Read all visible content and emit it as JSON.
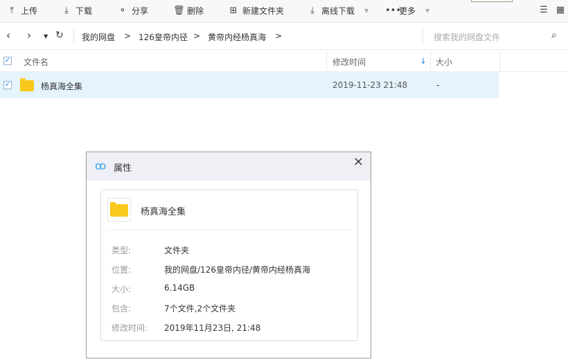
{
  "toolbar": {
    "upload": "上传",
    "download": "下载",
    "share": "分享",
    "delete": "删除",
    "new_folder": "新建文件夹",
    "offline_download": "离线下载",
    "more": "更多"
  },
  "nav": {
    "breadcrumb": [
      "我的网盘",
      "126皇帝内径",
      "黄帝内经杨真海"
    ],
    "search_placeholder": "搜索我的网盘文件"
  },
  "table": {
    "headers": {
      "name": "文件名",
      "modified": "修改时间",
      "size": "大小"
    },
    "rows": [
      {
        "name": "杨真海全集",
        "modified": "2019-11-23 21:48",
        "size": "-"
      }
    ]
  },
  "dialog": {
    "title": "属性",
    "file_name": "杨真海全集",
    "fields": [
      {
        "label": "类型:",
        "value": "文件夹"
      },
      {
        "label": "位置:",
        "value": "我的网盘/126皇帝内径/黄帝内经杨真海"
      },
      {
        "label": "大小:",
        "value": "6.14GB"
      },
      {
        "label": "包含:",
        "value": "7个文件,2个文件夹"
      },
      {
        "label": "修改时间:",
        "value": "2019年11月23日, 21:48"
      }
    ]
  },
  "colors": {
    "accent": "#1e88e5",
    "row_selected": "#e4f3fc",
    "folder": "#f8c91a"
  }
}
